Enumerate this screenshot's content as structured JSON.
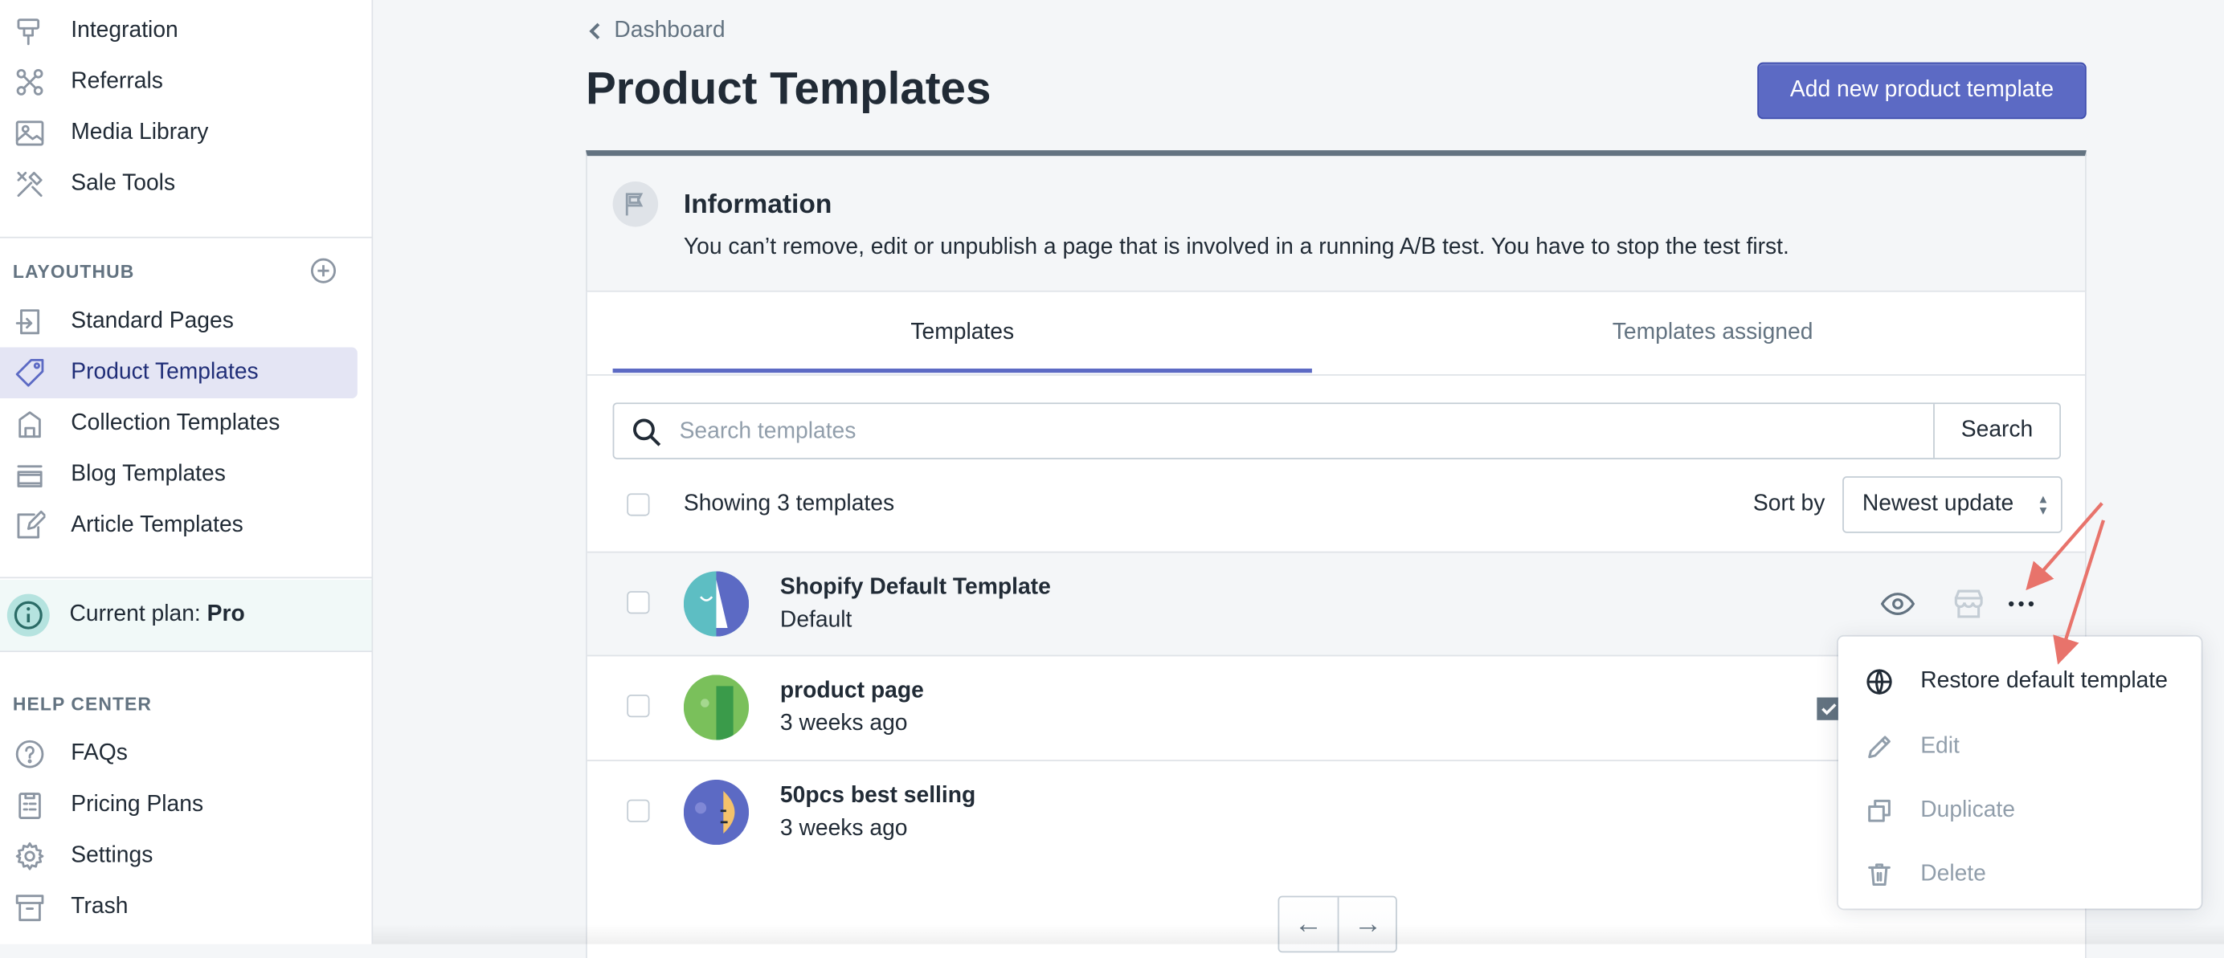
{
  "sidebar": {
    "top_items": [
      {
        "label": "Integration",
        "icon": "integration-icon"
      },
      {
        "label": "Referrals",
        "icon": "referrals-icon"
      },
      {
        "label": "Media Library",
        "icon": "image-icon"
      },
      {
        "label": "Sale Tools",
        "icon": "tools-icon"
      }
    ],
    "layouthub_heading": "LAYOUTHUB",
    "layouthub_items": [
      {
        "label": "Standard Pages",
        "icon": "page-icon"
      },
      {
        "label": "Product Templates",
        "icon": "tag-icon",
        "active": true
      },
      {
        "label": "Collection Templates",
        "icon": "collection-icon"
      },
      {
        "label": "Blog Templates",
        "icon": "blog-icon"
      },
      {
        "label": "Article Templates",
        "icon": "article-icon"
      }
    ],
    "plan_prefix": "Current plan: ",
    "plan_name": "Pro",
    "help_heading": "HELP CENTER",
    "help_items": [
      {
        "label": "FAQs",
        "icon": "question-icon"
      },
      {
        "label": "Pricing Plans",
        "icon": "clipboard-icon"
      },
      {
        "label": "Settings",
        "icon": "gear-icon"
      },
      {
        "label": "Trash",
        "icon": "archive-icon"
      }
    ]
  },
  "header": {
    "back_label": "Dashboard",
    "title": "Product Templates",
    "add_button": "Add new product template"
  },
  "info_banner": {
    "title": "Information",
    "text": "You can’t remove, edit or unpublish a page that is involved in a running A/B test. You have to stop the test first."
  },
  "tabs": [
    {
      "label": "Templates",
      "active": true
    },
    {
      "label": "Templates assigned",
      "active": false
    }
  ],
  "search": {
    "placeholder": "Search templates",
    "value": "",
    "button": "Search"
  },
  "list": {
    "showing_text": "Showing 3 templates",
    "sort_label": "Sort by",
    "sort_value": "Newest update"
  },
  "templates": [
    {
      "name": "Shopify Default Template",
      "subtitle": "Default"
    },
    {
      "name": "product page",
      "subtitle": "3 weeks ago"
    },
    {
      "name": "50pcs best selling",
      "subtitle": "3 weeks ago"
    }
  ],
  "context_menu": [
    {
      "label": "Restore default template",
      "icon": "globe-icon",
      "enabled": true
    },
    {
      "label": "Edit",
      "icon": "pencil-icon",
      "enabled": false
    },
    {
      "label": "Duplicate",
      "icon": "duplicate-icon",
      "enabled": false
    },
    {
      "label": "Delete",
      "icon": "trash-icon",
      "enabled": false
    }
  ],
  "pagination": {
    "prev": "←",
    "next": "→"
  },
  "colors": {
    "accent": "#5c6ac4",
    "active_nav_bg": "#e4e5f4",
    "annotation_arrow": "#e8736b"
  }
}
